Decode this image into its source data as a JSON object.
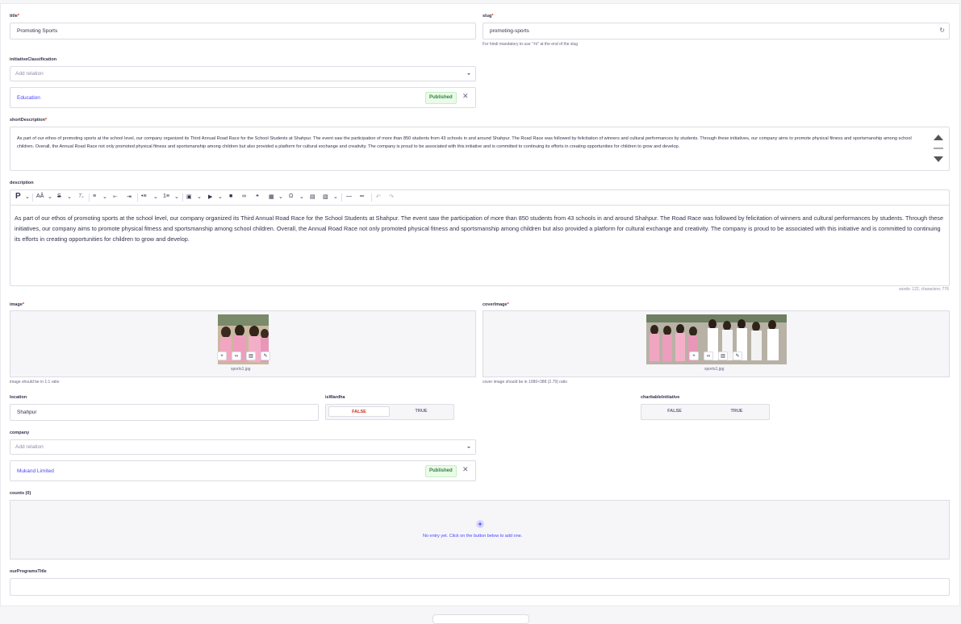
{
  "title_field": {
    "label": "title",
    "value": "Promoting Sports"
  },
  "slug_field": {
    "label": "slug",
    "value": "promoting-sports",
    "hint": "For hindi mandatory to use \"-hi\" at the end of the slug"
  },
  "initiative_classification": {
    "label": "initiativeClassification",
    "placeholder": "Add relation",
    "item": "Education",
    "status": "Published"
  },
  "short_description": {
    "label": "shortDescription",
    "text": "As part of our ethos of promoting sports at the school level, our company organized its Third Annual Road Race for the School Students at Shahpur. The event saw the participation of more than 850 students from 43 schools in and around Shahpur. The Road Race was followed by felicitation of winners and cultural performances by students. Through these initiatives, our company aims to promote physical fitness and sportsmanship among school children. Overall, the Annual Road Race not only promoted physical fitness and sportsmanship among children but also provided a platform for cultural exchange and creativity. The company is proud to be associated with this initiative and is committed to continuing its efforts in creating opportunities for children to grow and develop."
  },
  "description": {
    "label": "description",
    "text": "As part of our ethos of promoting sports at the school level, our company organized its Third Annual Road Race for the School Students at Shahpur. The event saw the participation of more than 850 students from 43 schools in and around Shahpur. The Road Race was followed by felicitation of winners and cultural performances by students. Through these initiatives, our company aims to promote physical fitness and sportsmanship among school children. Overall, the Annual Road Race not only promoted physical fitness and sportsmanship among children but also provided a platform for cultural exchange and creativity. The company is proud to be associated with this initiative and is committed to continuing its efforts in creating opportunities for children to grow and develop.",
    "word_count": "words: 122, characters: 776",
    "toolbar": {
      "paragraph": "P",
      "font_size": "AÂ",
      "strike": "S",
      "clear": "Tₓ",
      "align": "≡",
      "outdent": "⇤",
      "indent": "⇥",
      "bullets": "•≡",
      "numbers": "1≡",
      "image": "▣",
      "media": "▶",
      "file": "■",
      "link": "∞",
      "quote": "❝",
      "table": "▦",
      "special": "Ω",
      "html": "▤",
      "source": "▧",
      "hr": "—",
      "pagebreak": "═",
      "undo": "↶",
      "redo": "↷"
    }
  },
  "image_field": {
    "label": "image",
    "filename": "sports1.jpg",
    "hint": "image should be in 1:1 ratio"
  },
  "cover_image_field": {
    "label": "coverImage",
    "filename": "sports1.jpg",
    "hint": "cover image should be in 1086×388 (2.79) ratio"
  },
  "location_field": {
    "label": "location",
    "value": "Shahpur"
  },
  "is_wardha": {
    "label": "isWardha",
    "false_label": "FALSE",
    "true_label": "TRUE"
  },
  "charitable_initiative": {
    "label": "charitableInitiative",
    "false_label": "FALSE",
    "true_label": "TRUE"
  },
  "company": {
    "label": "company",
    "placeholder": "Add relation",
    "item": "Mukand Limited",
    "status": "Published"
  },
  "counts": {
    "label": "counts (0)",
    "empty_text": "No entry yet. Click on the button below to add one."
  },
  "our_programs_title": {
    "label": "ourProgramsTitle",
    "value": ""
  },
  "colors": {
    "accent": "#4945ff",
    "published_bg": "#eafbe7",
    "published_text": "#328048",
    "false_text": "#d02b20",
    "border": "#dcdce4"
  }
}
